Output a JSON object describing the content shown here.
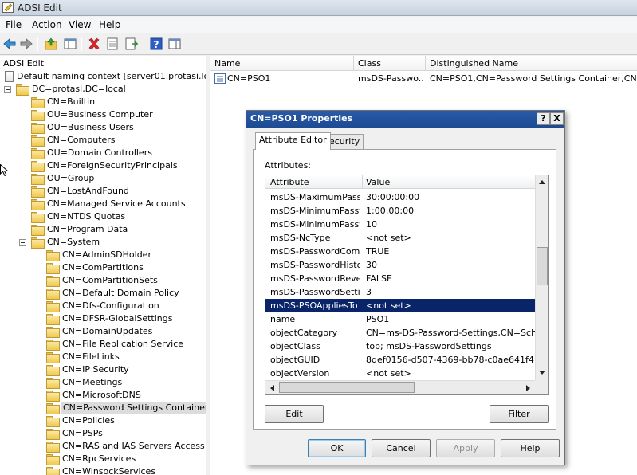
{
  "window": {
    "title": "ADSI Edit"
  },
  "menu": [
    "File",
    "Action",
    "View",
    "Help"
  ],
  "toolbar": {
    "icons": [
      "back-arrow-icon",
      "forward-arrow-icon",
      "up-folder-icon",
      "show-hide-tree-icon",
      "delete-icon",
      "properties-icon",
      "export-list-icon",
      "help-icon",
      "show-hide-action-pane-icon"
    ]
  },
  "tree": {
    "root": "ADSI Edit",
    "context": "Default naming context [server01.protasi.local]",
    "domain": "DC=protasi,DC=local",
    "level1": [
      "CN=Builtin",
      "OU=Business Computer",
      "OU=Business Users",
      "CN=Computers",
      "OU=Domain Controllers",
      "CN=ForeignSecurityPrincipals",
      "OU=Group",
      "CN=LostAndFound",
      "CN=Managed Service Accounts",
      "CN=NTDS Quotas",
      "CN=Program Data",
      "CN=System"
    ],
    "system_children": [
      "CN=AdminSDHolder",
      "CN=ComPartitions",
      "CN=ComPartitionSets",
      "CN=Default Domain Policy",
      "CN=Dfs-Configuration",
      "CN=DFSR-GlobalSettings",
      "CN=DomainUpdates",
      "CN=File Replication Service",
      "CN=FileLinks",
      "CN=IP Security",
      "CN=Meetings",
      "CN=MicrosoftDNS",
      "CN=Password Settings Container",
      "CN=Policies",
      "CN=PSPs",
      "CN=RAS and IAS Servers Access Che",
      "CN=RpcServices",
      "CN=WinsockServices"
    ],
    "selected": "CN=Password Settings Container"
  },
  "list": {
    "columns": [
      "Name",
      "Class",
      "Distinguished Name"
    ],
    "rows": [
      {
        "name": "CN=PSO1",
        "class": "msDS-Passwo...",
        "dn": "CN=PSO1,CN=Password Settings Container,CN=Syst"
      }
    ]
  },
  "dialog": {
    "title": "CN=PSO1 Properties",
    "help_btn": "?",
    "close_btn": "X",
    "tabs": [
      "Attribute Editor",
      "Security"
    ],
    "attributes_label": "Attributes:",
    "columns": [
      "Attribute",
      "Value"
    ],
    "rows": [
      {
        "attr": "msDS-MaximumPass...",
        "value": "30:00:00:00"
      },
      {
        "attr": "msDS-MinimumPassw...",
        "value": "1:00:00:00"
      },
      {
        "attr": "msDS-MinimumPassw...",
        "value": "10"
      },
      {
        "attr": "msDS-NcType",
        "value": "<not set>"
      },
      {
        "attr": "msDS-PasswordCom...",
        "value": "TRUE"
      },
      {
        "attr": "msDS-PasswordHisto...",
        "value": "30"
      },
      {
        "attr": "msDS-PasswordReve...",
        "value": "FALSE"
      },
      {
        "attr": "msDS-PasswordSetti...",
        "value": "3"
      },
      {
        "attr": "msDS-PSOAppliesTo",
        "value": "<not set>"
      },
      {
        "attr": "name",
        "value": "PSO1"
      },
      {
        "attr": "objectCategory",
        "value": "CN=ms-DS-Password-Settings,CN=Schema,C"
      },
      {
        "attr": "objectClass",
        "value": "top; msDS-PasswordSettings"
      },
      {
        "attr": "objectGUID",
        "value": "8def0156-d507-4369-bb78-c0ae641f4126"
      },
      {
        "attr": "objectVersion",
        "value": "<not set>"
      }
    ],
    "selected_row": "msDS-PSOAppliesTo",
    "edit_btn": "Edit",
    "filter_btn": "Filter",
    "ok_btn": "OK",
    "cancel_btn": "Cancel",
    "apply_btn": "Apply",
    "help_button": "Help"
  }
}
